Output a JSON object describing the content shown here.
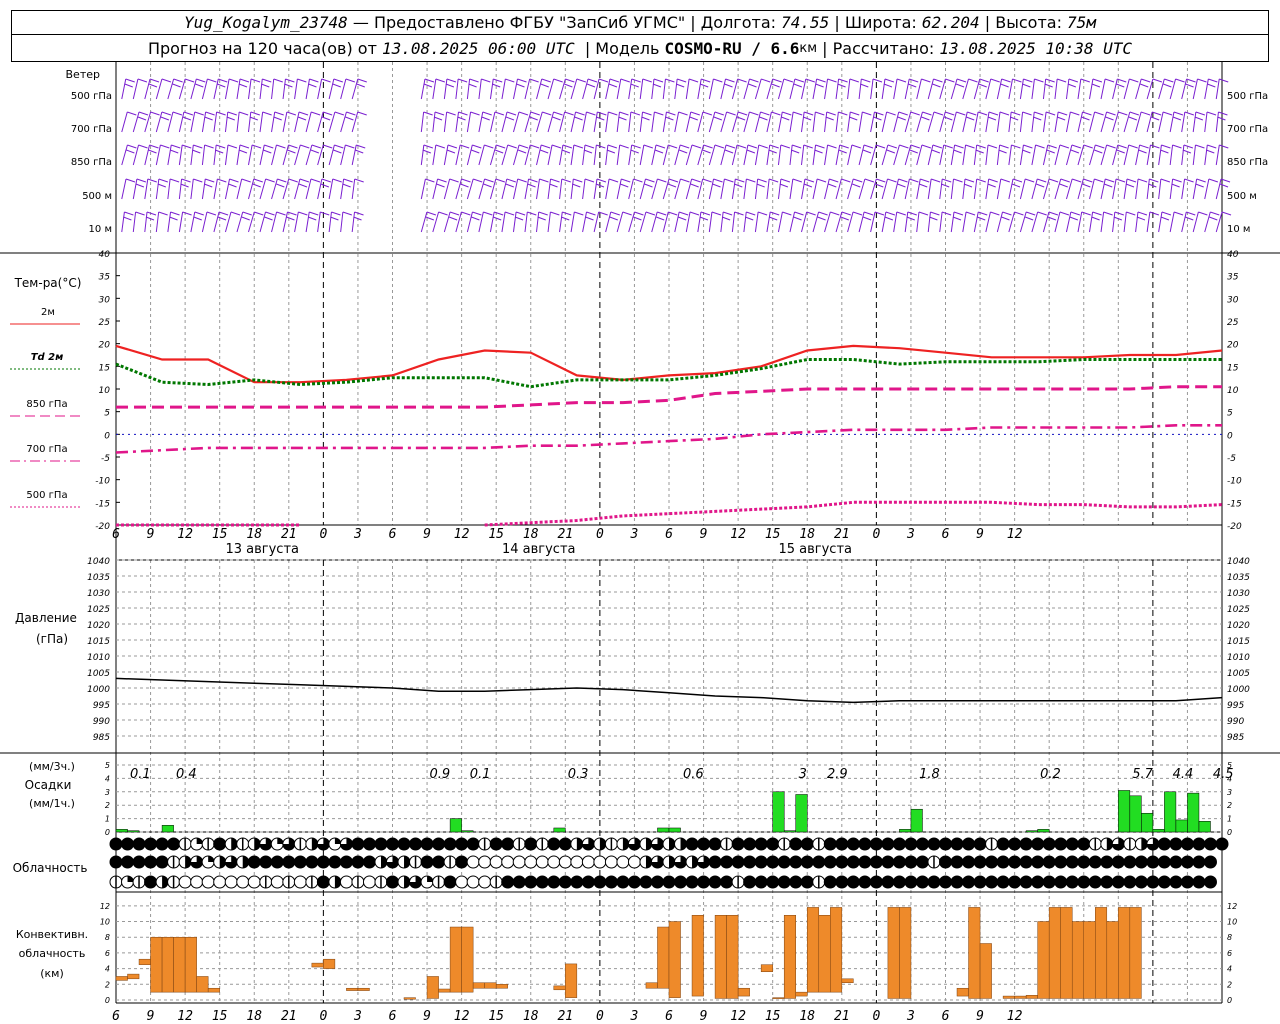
{
  "header": {
    "station": "Yug_Kogalym_23748",
    "provider": " — Предоставлено ФГБУ \"ЗапСиб УГМС\" | ",
    "lon_label": "Долгота: ",
    "lon": "74.55",
    "lat_label": " | Широта: ",
    "lat": "62.204",
    "alt_label": " | Высота: ",
    "alt": "75м",
    "forecast_label": "Прогноз на 120 часа(ов) от ",
    "forecast_time": "13.08.2025 06:00 UTC",
    "model_label": "  | Модель ",
    "model": "COSMO-RU / 6.6",
    "model_unit": "км",
    "calc_label": " | Рассчитано: ",
    "calc_time": "13.08.2025 10:38 UTC"
  },
  "labels": {
    "wind": "Ветер",
    "wind_levels": [
      "500 гПа",
      "700 гПа",
      "850 гПа",
      "500 м",
      "10  м"
    ],
    "temp_title": "Тем-ра(°C)",
    "temp_legend": [
      "2м",
      "Td  2м",
      "850 гПа",
      "700 гПа",
      "500 гПа"
    ],
    "pressure_title": "Давление",
    "pressure_unit": "(гПа)",
    "precip_unit3": "(мм/3ч.)",
    "precip_title": "Осадки",
    "precip_unit1": "(мм/1ч.)",
    "cloud_title": "Облачность",
    "conv_title": "Конвективн.",
    "conv_sub": "облачность",
    "conv_unit": "(км)"
  },
  "colors": {
    "t2m": "#ee2222",
    "td2m": "#007700",
    "t850": "#e0168a",
    "t700": "#e0168a",
    "t500": "#e0168a",
    "wind": "#7a1fd0",
    "precip": "#22dd22",
    "conv": "#ee8a2a",
    "grid": "#999999"
  },
  "chart_data": {
    "type": "line",
    "hours": [
      6,
      9,
      12,
      15,
      18,
      21,
      0,
      3,
      6,
      9,
      12,
      15,
      18,
      21,
      0,
      3,
      6,
      9,
      12,
      15,
      18,
      21,
      0,
      3,
      6,
      9,
      12
    ],
    "day_labels": [
      "13 августа",
      "14 августа",
      "15 августа"
    ],
    "temperature": {
      "ylim": [
        -20,
        40
      ],
      "ticks": [
        40,
        35,
        30,
        25,
        20,
        15,
        10,
        5,
        0,
        -5,
        -10,
        -15,
        -20
      ],
      "series": [
        {
          "name": "2м",
          "values": [
            19.5,
            16.5,
            16.5,
            11.5,
            11.5,
            12,
            13,
            16.5,
            18.5,
            18,
            13,
            12,
            13,
            13.5,
            15,
            18.5,
            19.5,
            19,
            18,
            17,
            17,
            17,
            17.5,
            17.5,
            18.5
          ]
        },
        {
          "name": "Td 2м",
          "values": [
            15.5,
            11.5,
            11,
            12,
            11,
            11.5,
            12.5,
            12.5,
            12.5,
            10.5,
            12,
            12,
            12,
            13,
            14.5,
            16.5,
            16.5,
            15.5,
            16,
            16,
            16,
            16.5,
            16.5,
            16.5,
            16.5
          ]
        },
        {
          "name": "850 гПа",
          "values": [
            6,
            6,
            6,
            6,
            6,
            6,
            6,
            6,
            6,
            6.5,
            7,
            7,
            7.5,
            9,
            9.5,
            10,
            10,
            10,
            10,
            10,
            10,
            10,
            10,
            10.5,
            10.5
          ]
        },
        {
          "name": "700 гПа",
          "values": [
            -4,
            -3.5,
            -3,
            -3,
            -3,
            -3,
            -3,
            -3,
            -3,
            -2.5,
            -2.5,
            -2,
            -1.5,
            -1,
            0,
            0.5,
            1,
            1,
            1,
            1.5,
            1.5,
            1.5,
            1.5,
            2,
            2
          ]
        },
        {
          "name": "500 гПа",
          "values": [
            -20,
            -20,
            -20,
            -20,
            -20,
            null,
            null,
            null,
            -20,
            -19.5,
            -19,
            -18,
            -17.5,
            -17,
            -16.5,
            -16,
            -15,
            -15,
            -15,
            -15,
            -15.5,
            -15.5,
            -16,
            -16,
            -15.5
          ]
        }
      ]
    },
    "pressure": {
      "ylim": [
        985,
        1040
      ],
      "ticks": [
        1040,
        1035,
        1030,
        1025,
        1020,
        1015,
        1010,
        1005,
        1000,
        995,
        990,
        985
      ],
      "values": [
        1003,
        1002.5,
        1002,
        1001.5,
        1001,
        1000.5,
        1000,
        999,
        999,
        999.5,
        1000,
        999.5,
        998.5,
        997.5,
        997,
        996,
        995.5,
        996,
        996,
        996,
        996,
        996,
        996,
        996,
        997
      ]
    },
    "precipitation": {
      "ylim": [
        0,
        5
      ],
      "ticks": [
        5,
        4,
        3,
        2,
        1,
        0
      ],
      "totals_3h": [
        "0.1",
        "0.4",
        "0.9",
        "0.1",
        "0.3",
        "0.6",
        "3",
        "2.9",
        "1.8",
        "0.2",
        "5.7",
        "4.4",
        "4.5"
      ],
      "hourly": [
        0.2,
        0.1,
        0,
        0,
        0.5,
        0,
        0,
        0,
        0,
        0,
        0,
        0,
        0,
        0,
        0,
        0,
        0,
        0,
        0,
        0,
        0,
        0,
        0,
        0,
        0,
        0,
        0,
        0,
        0,
        0,
        0,
        0,
        0,
        0,
        0,
        0,
        0,
        0,
        0,
        0,
        0,
        0,
        0,
        0,
        0,
        0,
        0,
        0,
        0,
        0,
        0,
        0,
        0,
        0,
        0,
        0,
        0,
        0,
        0,
        0,
        0,
        0,
        0,
        0,
        0,
        0,
        0,
        0,
        0,
        0,
        0,
        0,
        0,
        0,
        0,
        0,
        0,
        0,
        0,
        0,
        0,
        0,
        0,
        0,
        0,
        0,
        0,
        0,
        0,
        0,
        0,
        0,
        0,
        0,
        0,
        0,
        0,
        0,
        0,
        0,
        0,
        0,
        0,
        0,
        0,
        0,
        0,
        0,
        0,
        0,
        0,
        0,
        0,
        0,
        0,
        0,
        0,
        0,
        0,
        0,
        0
      ],
      "bars": [
        {
          "h": 0.5,
          "v": 0.2
        },
        {
          "h": 1.5,
          "v": 0.1
        },
        {
          "h": 4.5,
          "v": 0.5
        },
        {
          "h": 29.5,
          "v": 1
        },
        {
          "h": 30.5,
          "v": 0.1
        },
        {
          "h": 38.5,
          "v": 0.3
        },
        {
          "h": 47.5,
          "v": 0.3
        },
        {
          "h": 48.5,
          "v": 0.3
        },
        {
          "h": 57.5,
          "v": 3
        },
        {
          "h": 58.5,
          "v": 0.1
        },
        {
          "h": 59.5,
          "v": 2.8
        },
        {
          "h": 68.5,
          "v": 0.2
        },
        {
          "h": 69.5,
          "v": 1.7
        },
        {
          "h": 79.5,
          "v": 0.1
        },
        {
          "h": 80.5,
          "v": 0.2
        },
        {
          "h": 87.5,
          "v": 3.1
        },
        {
          "h": 88.5,
          "v": 2.7
        },
        {
          "h": 89.5,
          "v": 1.4
        },
        {
          "h": 90.5,
          "v": 0.2
        },
        {
          "h": 91.5,
          "v": 3
        },
        {
          "h": 92.5,
          "v": 0.9
        },
        {
          "h": 93.5,
          "v": 2.9
        },
        {
          "h": 94.5,
          "v": 0.8
        }
      ]
    },
    "convective": {
      "ylim": [
        0,
        13
      ],
      "ticks": [
        12,
        10,
        8,
        6,
        4,
        2,
        0
      ],
      "bars": [
        {
          "h": 0.5,
          "bot": 2.5,
          "top": 3
        },
        {
          "h": 1.5,
          "bot": 2.7,
          "top": 3.3
        },
        {
          "h": 2.5,
          "bot": 4.5,
          "top": 5.2
        },
        {
          "h": 3.5,
          "bot": 1,
          "top": 8
        },
        {
          "h": 4.5,
          "bot": 1,
          "top": 8
        },
        {
          "h": 5.5,
          "bot": 1,
          "top": 8
        },
        {
          "h": 6.5,
          "bot": 1,
          "top": 8
        },
        {
          "h": 7.5,
          "bot": 1,
          "top": 3
        },
        {
          "h": 8.5,
          "bot": 1,
          "top": 1.5
        },
        {
          "h": 17.5,
          "bot": 4.2,
          "top": 4.7
        },
        {
          "h": 18.5,
          "bot": 4,
          "top": 5.2
        },
        {
          "h": 20.5,
          "bot": 1.2,
          "top": 1.5
        },
        {
          "h": 21.5,
          "bot": 1.2,
          "top": 1.5
        },
        {
          "h": 25.5,
          "bot": 0.1,
          "top": 0.3
        },
        {
          "h": 27.5,
          "bot": 0.2,
          "top": 3
        },
        {
          "h": 28.5,
          "bot": 1,
          "top": 1.4
        },
        {
          "h": 29.5,
          "bot": 1,
          "top": 9.3
        },
        {
          "h": 30.5,
          "bot": 1,
          "top": 9.3
        },
        {
          "h": 31.5,
          "bot": 1.5,
          "top": 2.2
        },
        {
          "h": 32.5,
          "bot": 1.5,
          "top": 2.2
        },
        {
          "h": 33.5,
          "bot": 1.5,
          "top": 2
        },
        {
          "h": 38.5,
          "bot": 1.3,
          "top": 1.8
        },
        {
          "h": 39.5,
          "bot": 0.3,
          "top": 4.6
        },
        {
          "h": 46.5,
          "bot": 1.5,
          "top": 2.2
        },
        {
          "h": 47.5,
          "bot": 1.5,
          "top": 9.3
        },
        {
          "h": 48.5,
          "bot": 0.3,
          "top": 10
        },
        {
          "h": 50.5,
          "bot": 0.5,
          "top": 10.8
        },
        {
          "h": 52.5,
          "bot": 0.2,
          "top": 10.8
        },
        {
          "h": 53.5,
          "bot": 0.2,
          "top": 10.8
        },
        {
          "h": 54.5,
          "bot": 0.5,
          "top": 1.5
        },
        {
          "h": 56.5,
          "bot": 3.6,
          "top": 4.5
        },
        {
          "h": 57.5,
          "bot": 0.2,
          "top": 0.3
        },
        {
          "h": 58.5,
          "bot": 0.2,
          "top": 10.8
        },
        {
          "h": 59.5,
          "bot": 0.5,
          "top": 1
        },
        {
          "h": 60.5,
          "bot": 1,
          "top": 11.8
        },
        {
          "h": 61.5,
          "bot": 1,
          "top": 10.8
        },
        {
          "h": 62.5,
          "bot": 1,
          "top": 11.8
        },
        {
          "h": 63.5,
          "bot": 2.2,
          "top": 2.7
        },
        {
          "h": 67.5,
          "bot": 0.2,
          "top": 11.8
        },
        {
          "h": 68.5,
          "bot": 0.2,
          "top": 11.8
        },
        {
          "h": 73.5,
          "bot": 0.5,
          "top": 1.5
        },
        {
          "h": 74.5,
          "bot": 0.2,
          "top": 11.8
        },
        {
          "h": 75.5,
          "bot": 0.2,
          "top": 7.2
        },
        {
          "h": 77.5,
          "bot": 0.2,
          "top": 0.5
        },
        {
          "h": 78.5,
          "bot": 0.2,
          "top": 0.5
        },
        {
          "h": 79.5,
          "bot": 0.2,
          "top": 0.6
        },
        {
          "h": 80.5,
          "bot": 0.2,
          "top": 10
        },
        {
          "h": 81.5,
          "bot": 0.2,
          "top": 11.8
        },
        {
          "h": 82.5,
          "bot": 0.2,
          "top": 11.8
        },
        {
          "h": 83.5,
          "bot": 0.2,
          "top": 10
        },
        {
          "h": 84.5,
          "bot": 0.2,
          "top": 10
        },
        {
          "h": 85.5,
          "bot": 0.2,
          "top": 11.8
        },
        {
          "h": 86.5,
          "bot": 0.2,
          "top": 10
        },
        {
          "h": 87.5,
          "bot": 0.2,
          "top": 11.8
        },
        {
          "h": 88.5,
          "bot": 0.2,
          "top": 11.8
        }
      ]
    },
    "clouds": {
      "rows": [
        "aaaaaa1d1ab1bcdc1bcdcaaaaaaaaaaa1aa1a1aabcb1bcbcbbaaa1aaaa1aa1aaaaaaaaaaaaaa1aaaaaaaa1bc1bcaaaaaa",
        "aaaaa1bcdbcbaaaaaaaaaaabcb1aa1aooooooooooooooobcbcbcaaaaaaaaaaaaaaaaaaa1aaaaaaaaaaaaaaaaaaaaaaaa",
        "1d1ab1ooooooo1o1o1abo1o1abcd1aooo1aaaaaaaaaaaaaaaaaaaa1aaaaaa1aaaaaaaaaaaaaaaaaaaaaaaaaaaaaaaaaa"
      ]
    }
  }
}
